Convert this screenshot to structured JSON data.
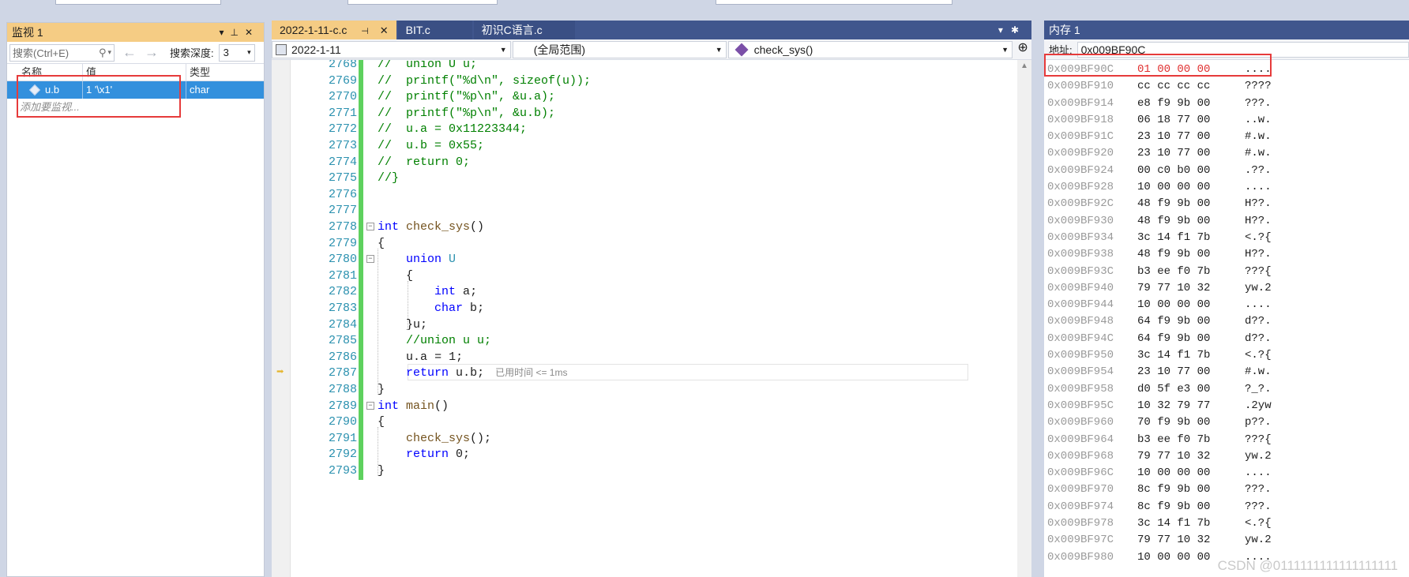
{
  "watch": {
    "title": "监视 1",
    "search_placeholder": "搜索(Ctrl+E)",
    "depth_label": "搜索深度:",
    "depth_value": "3",
    "columns": [
      "名称",
      "值",
      "类型"
    ],
    "rows": [
      {
        "name": "u.b",
        "value": "1 '\\x1'",
        "type": "char"
      }
    ],
    "add_label": "添加要监视..."
  },
  "editor": {
    "tabs": [
      {
        "label": "2022-1-11-c.c",
        "active": true
      },
      {
        "label": "BIT.c",
        "active": false
      },
      {
        "label": "初识C语言.c",
        "active": false
      }
    ],
    "nav": {
      "project": "2022-1-11",
      "scope": "(全局范围)",
      "function": "check_sys()"
    },
    "perf_tip": "已用时间 <= 1ms",
    "lines": [
      {
        "n": "2768",
        "text": "//  union U u;"
      },
      {
        "n": "2769",
        "text": "//  printf(\"%d\\n\", sizeof(u));"
      },
      {
        "n": "2770",
        "text": "//  printf(\"%p\\n\", &u.a);"
      },
      {
        "n": "2771",
        "text": "//  printf(\"%p\\n\", &u.b);"
      },
      {
        "n": "2772",
        "text": "//  u.a = 0x11223344;"
      },
      {
        "n": "2773",
        "text": "//  u.b = 0x55;"
      },
      {
        "n": "2774",
        "text": "//  return 0;"
      },
      {
        "n": "2775",
        "text": "//}"
      },
      {
        "n": "2776",
        "text": ""
      },
      {
        "n": "2777",
        "text": ""
      },
      {
        "n": "2778",
        "text": "int check_sys()"
      },
      {
        "n": "2779",
        "text": "{"
      },
      {
        "n": "2780",
        "text": "    union U"
      },
      {
        "n": "2781",
        "text": "    {"
      },
      {
        "n": "2782",
        "text": "        int a;"
      },
      {
        "n": "2783",
        "text": "        char b;"
      },
      {
        "n": "2784",
        "text": "    }u;"
      },
      {
        "n": "2785",
        "text": "    //union u u;"
      },
      {
        "n": "2786",
        "text": "    u.a = 1;"
      },
      {
        "n": "2787",
        "text": "    return u.b;"
      },
      {
        "n": "2788",
        "text": "}"
      },
      {
        "n": "2789",
        "text": "int main()"
      },
      {
        "n": "2790",
        "text": "{"
      },
      {
        "n": "2791",
        "text": "    check_sys();"
      },
      {
        "n": "2792",
        "text": "    return 0;"
      },
      {
        "n": "2793",
        "text": "}"
      }
    ]
  },
  "memory": {
    "title": "内存 1",
    "address_label": "地址:",
    "address_value": "0x009BF90C",
    "rows": [
      {
        "addr": "0x009BF90C",
        "bytes": "01 00 00 00",
        "ascii": "....",
        "changed": true
      },
      {
        "addr": "0x009BF910",
        "bytes": "cc cc cc cc",
        "ascii": "????"
      },
      {
        "addr": "0x009BF914",
        "bytes": "e8 f9 9b 00",
        "ascii": "???."
      },
      {
        "addr": "0x009BF918",
        "bytes": "06 18 77 00",
        "ascii": "..w."
      },
      {
        "addr": "0x009BF91C",
        "bytes": "23 10 77 00",
        "ascii": "#.w."
      },
      {
        "addr": "0x009BF920",
        "bytes": "23 10 77 00",
        "ascii": "#.w."
      },
      {
        "addr": "0x009BF924",
        "bytes": "00 c0 b0 00",
        "ascii": ".??."
      },
      {
        "addr": "0x009BF928",
        "bytes": "10 00 00 00",
        "ascii": "...."
      },
      {
        "addr": "0x009BF92C",
        "bytes": "48 f9 9b 00",
        "ascii": "H??."
      },
      {
        "addr": "0x009BF930",
        "bytes": "48 f9 9b 00",
        "ascii": "H??."
      },
      {
        "addr": "0x009BF934",
        "bytes": "3c 14 f1 7b",
        "ascii": "<.?{"
      },
      {
        "addr": "0x009BF938",
        "bytes": "48 f9 9b 00",
        "ascii": "H??."
      },
      {
        "addr": "0x009BF93C",
        "bytes": "b3 ee f0 7b",
        "ascii": "???{"
      },
      {
        "addr": "0x009BF940",
        "bytes": "79 77 10 32",
        "ascii": "yw.2"
      },
      {
        "addr": "0x009BF944",
        "bytes": "10 00 00 00",
        "ascii": "...."
      },
      {
        "addr": "0x009BF948",
        "bytes": "64 f9 9b 00",
        "ascii": "d??."
      },
      {
        "addr": "0x009BF94C",
        "bytes": "64 f9 9b 00",
        "ascii": "d??."
      },
      {
        "addr": "0x009BF950",
        "bytes": "3c 14 f1 7b",
        "ascii": "<.?{"
      },
      {
        "addr": "0x009BF954",
        "bytes": "23 10 77 00",
        "ascii": "#.w."
      },
      {
        "addr": "0x009BF958",
        "bytes": "d0 5f e3 00",
        "ascii": "?_?."
      },
      {
        "addr": "0x009BF95C",
        "bytes": "10 32 79 77",
        "ascii": ".2yw"
      },
      {
        "addr": "0x009BF960",
        "bytes": "70 f9 9b 00",
        "ascii": "p??."
      },
      {
        "addr": "0x009BF964",
        "bytes": "b3 ee f0 7b",
        "ascii": "???{"
      },
      {
        "addr": "0x009BF968",
        "bytes": "79 77 10 32",
        "ascii": "yw.2"
      },
      {
        "addr": "0x009BF96C",
        "bytes": "10 00 00 00",
        "ascii": "...."
      },
      {
        "addr": "0x009BF970",
        "bytes": "8c f9 9b 00",
        "ascii": "???."
      },
      {
        "addr": "0x009BF974",
        "bytes": "8c f9 9b 00",
        "ascii": "???."
      },
      {
        "addr": "0x009BF978",
        "bytes": "3c 14 f1 7b",
        "ascii": "<.?{"
      },
      {
        "addr": "0x009BF97C",
        "bytes": "79 77 10 32",
        "ascii": "yw.2"
      },
      {
        "addr": "0x009BF980",
        "bytes": "10 00 00 00",
        "ascii": "...."
      }
    ],
    "watermark": "CSDN @0111111111111111111"
  },
  "colors": {
    "accent_tab": "#f5cc84",
    "chrome": "#40568d",
    "selection": "#3390dd",
    "highlight_box": "#e63b3b",
    "changed_bytes": "#e03030"
  }
}
